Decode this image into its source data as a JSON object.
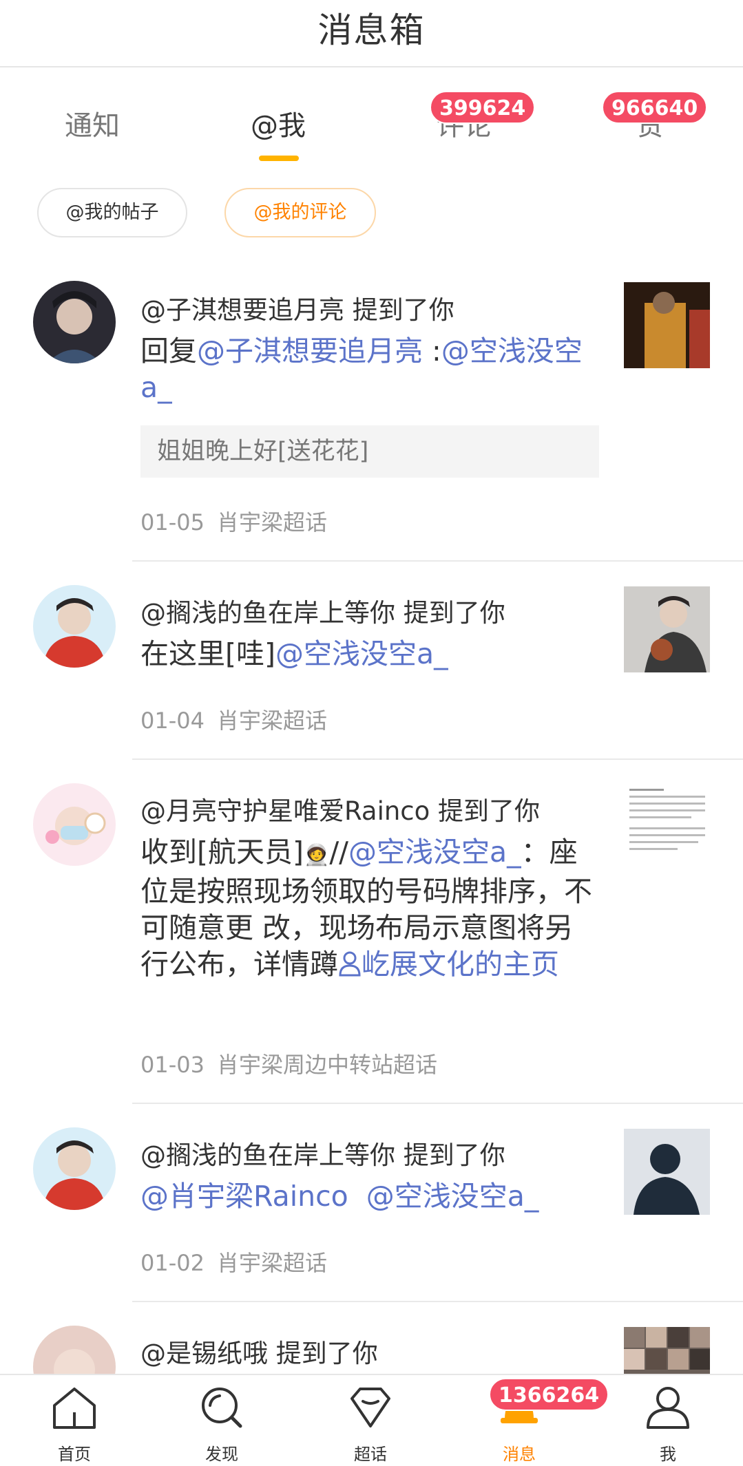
{
  "header": {
    "title": "消息箱"
  },
  "tabs": [
    {
      "label": "通知"
    },
    {
      "label": "@我"
    },
    {
      "label": "评论",
      "badge": "399624"
    },
    {
      "label": "赞",
      "badge": "966640"
    }
  ],
  "filters": [
    {
      "label": "@我的帖子"
    },
    {
      "label": "@我的评论"
    }
  ],
  "feed": [
    {
      "name": "@子淇想要追月亮 提到了你",
      "body_prefix": "回复",
      "body_link1": "@子淇想要追月亮",
      "body_mid": " :",
      "body_link2": "@空浅没空a_",
      "quote": "姐姐晚上好[送花花]",
      "date": "01-05",
      "topic": "肖宇梁超话"
    },
    {
      "name": "@搁浅的鱼在岸上等你 提到了你",
      "body_prefix": "在这里[哇]",
      "body_link1": "@空浅没空a_",
      "date": "01-04",
      "topic": "肖宇梁超话"
    },
    {
      "name": "@月亮守护星唯爱Rainco 提到了你",
      "body_prefix": "收到[航天员]",
      "body_emoji": "🧑‍🚀",
      "body_mid": "//",
      "body_link1": "@空浅没空a_",
      "body_text": "：座位是按照现场领取的号码牌排序，不可随意更 改，现场布局示意图将另行公布，详情蹲",
      "body_link2": "屹展文化的主页",
      "date": "01-03",
      "topic": "肖宇梁周边中转站超话"
    },
    {
      "name": "@搁浅的鱼在岸上等你 提到了你",
      "body_link1": "@肖宇梁Rainco",
      "body_link2": "@空浅没空a_",
      "date": "01-02",
      "topic": "肖宇梁超话"
    },
    {
      "name": "@是锡纸哦 提到了你"
    }
  ],
  "nav": [
    {
      "label": "首页",
      "icon": "home-icon"
    },
    {
      "label": "发现",
      "icon": "search-icon"
    },
    {
      "label": "超话",
      "icon": "diamond-icon"
    },
    {
      "label": "消息",
      "icon": "bell-icon",
      "badge": "1366264"
    },
    {
      "label": "我",
      "icon": "profile-icon"
    }
  ],
  "colors": {
    "accent": "#ff8200",
    "link": "#5b73c9",
    "badge": "#f44b63",
    "tab_indicator": "#ffb300"
  }
}
